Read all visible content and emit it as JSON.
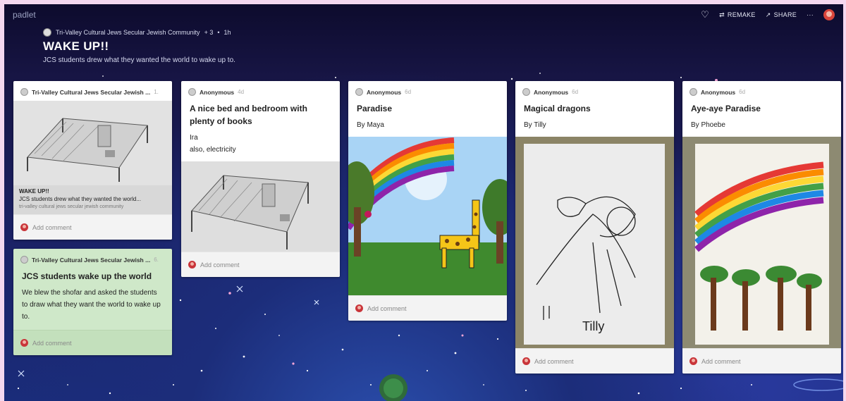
{
  "topbar": {
    "brand": "padlet",
    "remake_label": "REMAKE",
    "share_label": "SHARE",
    "more_label": "···"
  },
  "header": {
    "author": "Tri-Valley Cultural Jews Secular Jewish Community",
    "contributors": "+ 3",
    "age": "1h",
    "title": "WAKE UP!!",
    "subtitle": "JCS students drew what they wanted the world to wake up to."
  },
  "posts": [
    {
      "author": "Tri-Valley Cultural Jews Secular Jewish ...",
      "time": "1.",
      "link_title": "WAKE UP!!",
      "link_desc": "JCS students drew what they wanted the world...",
      "link_source": "tri-valley cultural jews secular jewish community",
      "comment": "Add comment",
      "image": "bed-drawing"
    },
    {
      "author": "Tri-Valley Cultural Jews Secular Jewish ...",
      "time": "6.",
      "title": "JCS students wake up the world",
      "body": "We blew the shofar and asked the students to draw what they want the world to wake up to.",
      "comment": "Add comment"
    },
    {
      "author": "Anonymous",
      "time": "4d",
      "title": "A nice bed and bedroom with plenty of books",
      "body_lines": [
        "Ira",
        "also, electricity"
      ],
      "comment": "Add comment",
      "image": "bed-drawing"
    },
    {
      "author": "Anonymous",
      "time": "6d",
      "title": "Paradise",
      "body": "By Maya",
      "comment": "Add comment",
      "image": "rainbow-giraffe"
    },
    {
      "author": "Anonymous",
      "time": "6d",
      "title": "Magical dragons",
      "body": "By Tilly",
      "comment": "Add comment",
      "image": "dragon-drawing",
      "image_signature": "Tilly"
    },
    {
      "author": "Anonymous",
      "time": "6d",
      "title": "Aye-aye Paradise",
      "body": "By Phoebe",
      "comment": "Add comment",
      "image": "rainbow-trees"
    }
  ]
}
